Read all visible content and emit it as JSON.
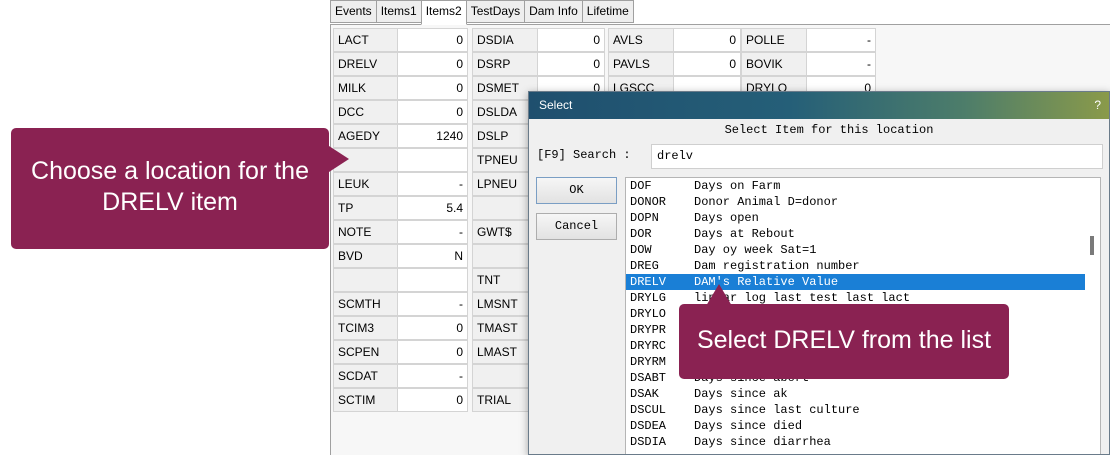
{
  "tabs": [
    "Events",
    "Items1",
    "Items2",
    "TestDays",
    "Dam Info",
    "Lifetime"
  ],
  "active_tab": "Items2",
  "grid": {
    "rows": [
      [
        "LACT",
        "0",
        "DSDIA",
        "0",
        "AVLS",
        "0",
        "POLLE",
        "-"
      ],
      [
        "DRELV",
        "0",
        "DSRP",
        "0",
        "PAVLS",
        "0",
        "BOVIK",
        "-"
      ],
      [
        "MILK",
        "0",
        "DSMET",
        "0",
        "LGSCC",
        "",
        "DRYLO",
        "0"
      ],
      [
        "DCC",
        "0",
        "DSLDA",
        "",
        "",
        "",
        "",
        ""
      ],
      [
        "AGEDY",
        "1240",
        "DSLP",
        "",
        "",
        "",
        "",
        ""
      ],
      [
        "",
        "",
        "TPNEU",
        "",
        "",
        "",
        "",
        ""
      ],
      [
        "LEUK",
        "-",
        "LPNEU",
        "",
        "",
        "",
        "",
        ""
      ],
      [
        "TP",
        "5.4",
        "",
        "",
        "",
        "",
        "",
        ""
      ],
      [
        "NOTE",
        "-",
        "GWT$",
        "",
        "",
        "",
        "",
        ""
      ],
      [
        "BVD",
        "N",
        "",
        "",
        "",
        "",
        "",
        ""
      ],
      [
        "",
        "",
        "TNT",
        "",
        "",
        "",
        "",
        ""
      ],
      [
        "SCMTH",
        "-",
        "LMSNT",
        "",
        "",
        "",
        "",
        ""
      ],
      [
        "TCIM3",
        "0",
        "TMAST",
        "",
        "",
        "",
        "",
        ""
      ],
      [
        "SCPEN",
        "0",
        "LMAST",
        "",
        "",
        "",
        "",
        ""
      ],
      [
        "SCDAT",
        "-",
        "",
        "",
        "",
        "",
        "",
        ""
      ],
      [
        "SCTIM",
        "0",
        "TRIAL",
        "",
        "",
        "",
        "",
        ""
      ]
    ]
  },
  "dialog": {
    "title": "Select",
    "help": "?",
    "heading": "Select Item for this location",
    "search_label": "[F9] Search :",
    "search_value": "drelv",
    "ok_label": "OK",
    "cancel_label": "Cancel",
    "items": [
      {
        "code": "DOF",
        "desc": "Days on Farm"
      },
      {
        "code": "DONOR",
        "desc": "Donor Animal D=donor"
      },
      {
        "code": "DOPN",
        "desc": "Days open"
      },
      {
        "code": "DOR",
        "desc": "Days at Rebout"
      },
      {
        "code": "DOW",
        "desc": "Day oy week Sat=1"
      },
      {
        "code": "DREG",
        "desc": "Dam registration number"
      },
      {
        "code": "DRELV",
        "desc": "DAM's Relative Value"
      },
      {
        "code": "DRYLG",
        "desc": "linear log last test last lact"
      },
      {
        "code": "DRYLO",
        "desc": ""
      },
      {
        "code": "DRYPR",
        "desc": ""
      },
      {
        "code": "DRYRC",
        "desc": ""
      },
      {
        "code": "DRYRM",
        "desc": ""
      },
      {
        "code": "DSABT",
        "desc": "Days since abort"
      },
      {
        "code": "DSAK",
        "desc": "Days since ak"
      },
      {
        "code": "DSCUL",
        "desc": "Days since last culture"
      },
      {
        "code": "DSDEA",
        "desc": "Days since died"
      },
      {
        "code": "DSDIA",
        "desc": "Days since diarrhea"
      }
    ],
    "selected_code": "DRELV"
  },
  "callouts": {
    "left": "Choose a location for the DRELV item",
    "right": "Select DRELV from the list"
  },
  "colors": {
    "callout": "#8a2252",
    "selection": "#1a7fd6"
  }
}
